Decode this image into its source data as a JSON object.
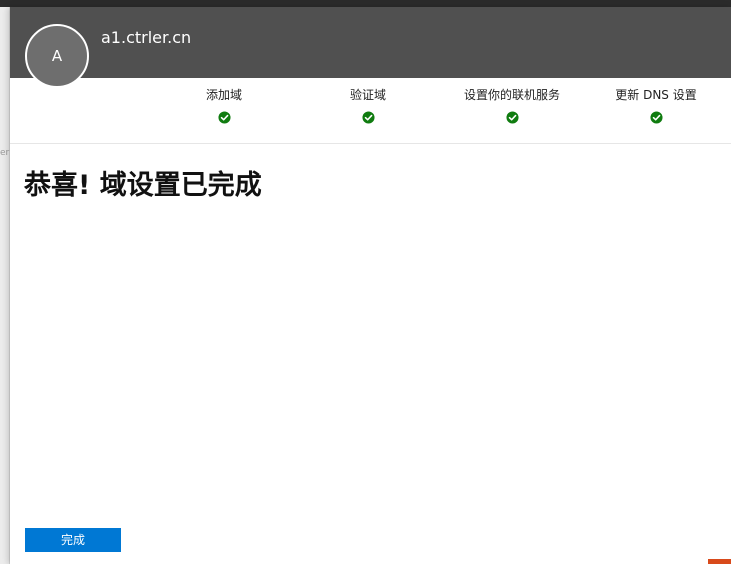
{
  "header": {
    "avatar_initial": "A",
    "domain_name": "a1.ctrler.cn"
  },
  "steps": [
    {
      "label": "添加域",
      "status": "complete"
    },
    {
      "label": "验证域",
      "status": "complete"
    },
    {
      "label": "设置你的联机服务",
      "status": "complete"
    },
    {
      "label": "更新 DNS 设置",
      "status": "complete"
    }
  ],
  "main": {
    "heading": "恭喜! 域设置已完成"
  },
  "footer": {
    "done_label": "完成"
  },
  "background": {
    "edge_hint": "er"
  },
  "colors": {
    "header_bg": "#505050",
    "accent": "#0078d4",
    "check_green": "#107c10",
    "corner_orange": "#d84a1b"
  },
  "icons": {
    "step_status": "check-circle-icon"
  }
}
